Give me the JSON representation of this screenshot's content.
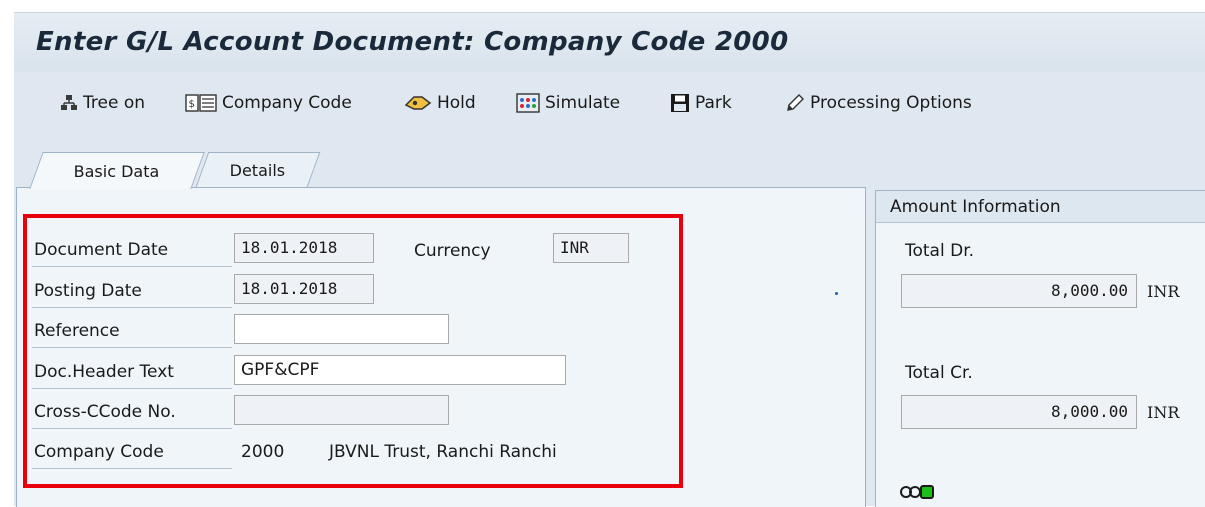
{
  "window": {
    "title": "Enter G/L Account Document: Company Code 2000"
  },
  "toolbar": {
    "items": [
      {
        "label": "Tree on",
        "icon": "tree-icon"
      },
      {
        "label": "Company Code",
        "icon": "company-code-icon"
      },
      {
        "label": "Hold",
        "icon": "hold-icon"
      },
      {
        "label": "Simulate",
        "icon": "simulate-icon"
      },
      {
        "label": "Park",
        "icon": "park-icon"
      },
      {
        "label": "Processing Options",
        "icon": "pencil-icon"
      }
    ]
  },
  "tabs": [
    {
      "label": "Basic Data",
      "active": true
    },
    {
      "label": "Details",
      "active": false
    }
  ],
  "form": {
    "document_date": {
      "label": "Document Date",
      "value": "18.01.2018"
    },
    "currency": {
      "label": "Currency",
      "value": "INR"
    },
    "posting_date": {
      "label": "Posting Date",
      "value": "18.01.2018"
    },
    "reference": {
      "label": "Reference",
      "value": ""
    },
    "header_text": {
      "label": "Doc.Header Text",
      "value": "GPF&CPF"
    },
    "cross_ccode": {
      "label": "Cross-CCode No.",
      "value": ""
    },
    "company_code": {
      "label": "Company Code",
      "value": "2000",
      "name": "JBVNL Trust, Ranchi Ranchi"
    }
  },
  "amount_info": {
    "header": "Amount Information",
    "total_dr": {
      "label": "Total Dr.",
      "value": "8,000.00",
      "currency": "INR"
    },
    "total_cr": {
      "label": "Total Cr.",
      "value": "8,000.00",
      "currency": "INR"
    },
    "status_color": "#19c019"
  },
  "colors": {
    "highlight": "#e8000d",
    "toolbar_bg": "#dfe8f0"
  }
}
